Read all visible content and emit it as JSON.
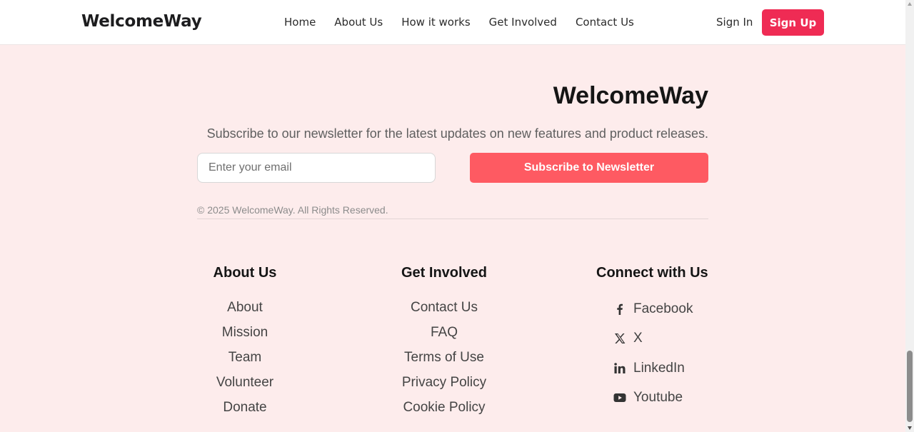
{
  "header": {
    "brand": "WelcomeWay",
    "nav": [
      "Home",
      "About Us",
      "How it works",
      "Get Involved",
      "Contact Us"
    ],
    "sign_in": "Sign In",
    "sign_up": "Sign Up"
  },
  "footer": {
    "brand": "WelcomeWay",
    "description": "Subscribe to our newsletter for the latest updates on new features and product releases.",
    "email_placeholder": "Enter your email",
    "subscribe_label": "Subscribe to Newsletter",
    "copyright": "© 2025 WelcomeWay. All Rights Reserved.",
    "columns": {
      "about": {
        "title": "About Us",
        "links": [
          "About",
          "Mission",
          "Team",
          "Volunteer",
          "Donate"
        ]
      },
      "involved": {
        "title": "Get Involved",
        "links": [
          "Contact Us",
          "FAQ",
          "Terms of Use",
          "Privacy Policy",
          "Cookie Policy"
        ]
      },
      "connect": {
        "title": "Connect with Us",
        "links": [
          {
            "label": "Facebook",
            "icon": "facebook-icon"
          },
          {
            "label": "X",
            "icon": "x-icon"
          },
          {
            "label": "LinkedIn",
            "icon": "linkedin-icon"
          },
          {
            "label": "Youtube",
            "icon": "youtube-icon"
          }
        ]
      }
    }
  },
  "colors": {
    "accent": "#ef2b54",
    "subscribe": "#fe5a62",
    "background": "#fdecec"
  }
}
